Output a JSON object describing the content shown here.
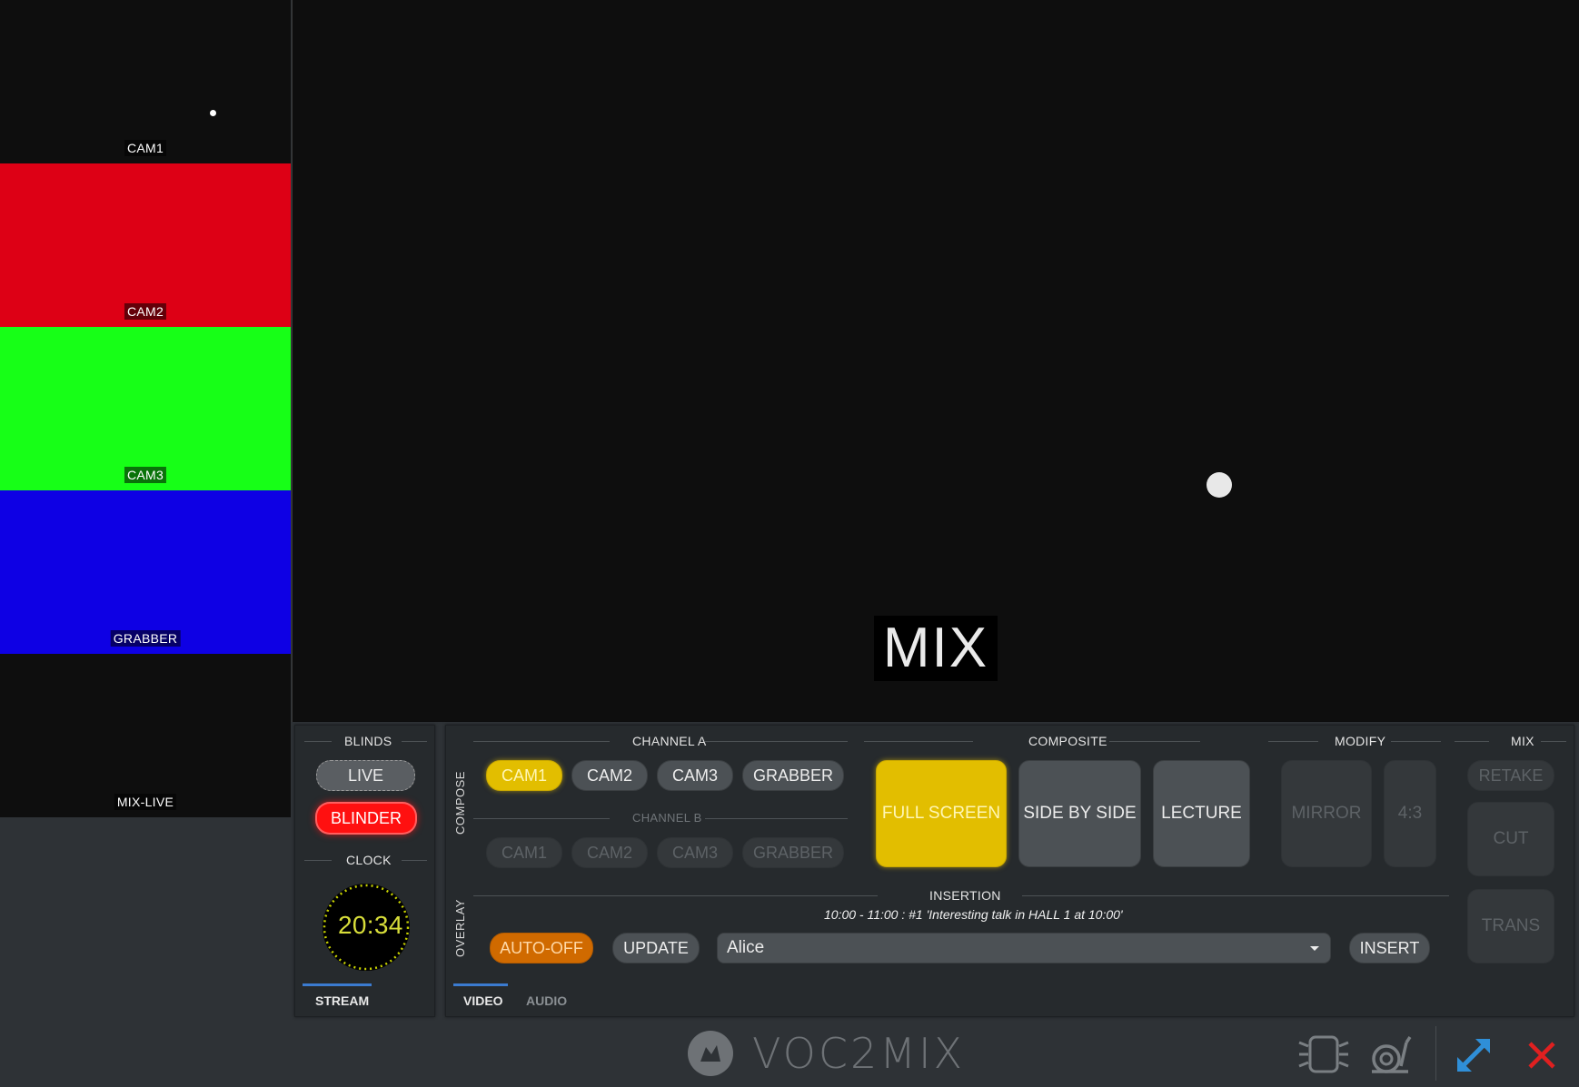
{
  "sources": [
    {
      "label": "CAM1",
      "color": "#0e0e0e"
    },
    {
      "label": "CAM2",
      "color": "#dd0015"
    },
    {
      "label": "CAM3",
      "color": "#17ff17"
    },
    {
      "label": "GRABBER",
      "color": "#0e00e4"
    },
    {
      "label": "MIX-LIVE",
      "color": "#0e0e0e"
    }
  ],
  "main_preview": {
    "label": "MIX"
  },
  "blinds": {
    "title": "BLINDS",
    "live_label": "LIVE",
    "blinder_label": "BLINDER"
  },
  "clock": {
    "title": "CLOCK",
    "time": "20:34"
  },
  "stream_tab": {
    "label": "STREAM"
  },
  "compose": {
    "vertical_label": "COMPOSE",
    "channel_a_title": "CHANNEL A",
    "channel_a": [
      "CAM1",
      "CAM2",
      "CAM3",
      "GRABBER"
    ],
    "channel_a_selected": "CAM1",
    "channel_b_title": "CHANNEL B",
    "channel_b": [
      "CAM1",
      "CAM2",
      "CAM3",
      "GRABBER"
    ]
  },
  "composite": {
    "title": "COMPOSITE",
    "buttons": [
      "FULL SCREEN",
      "SIDE BY SIDE",
      "LECTURE"
    ],
    "selected": "FULL SCREEN"
  },
  "modify": {
    "title": "MODIFY",
    "buttons": [
      "MIRROR",
      "4:3"
    ]
  },
  "mix": {
    "title": "MIX",
    "buttons": [
      "RETAKE",
      "CUT",
      "TRANS"
    ]
  },
  "overlay": {
    "vertical_label": "OVERLAY",
    "insertion_title": "INSERTION",
    "insertion_text": "10:00 - 11:00 : #1  'Interesting talk in HALL 1 at 10:00'",
    "auto_off_label": "AUTO-OFF",
    "update_label": "UPDATE",
    "selected_value": "Alice",
    "insert_label": "INSERT"
  },
  "tabs": {
    "video": "VIDEO",
    "audio": "AUDIO"
  },
  "footer": {
    "app_name": "VOC2MIX"
  },
  "colors": {
    "accent_yellow": "#e2be00",
    "blinder_red": "#ff1010",
    "auto_off_orange": "#d06a00",
    "close_red": "#e02020",
    "expand_blue": "#2f8fd8"
  }
}
